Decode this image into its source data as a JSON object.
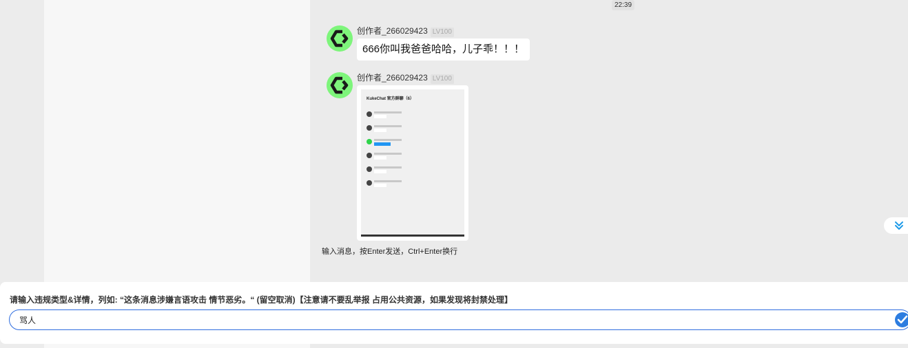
{
  "chat": {
    "timestamp": "22:39",
    "messages": [
      {
        "sender": "创作者_266029423",
        "level": "LV100",
        "text": "666你叫我爸爸哈哈，儿子乖！！！"
      },
      {
        "sender": "创作者_266029423",
        "level": "LV100",
        "image": {
          "title": "KukeChat 官方群聊（6）"
        }
      }
    ],
    "input_hint": "输入消息，按Enter发送，Ctrl+Enter换行"
  },
  "report": {
    "label": "请输入违规类型&详情，列如: “这条消息涉嫌言语攻击 情节恶劣。“ (留空取消)【注意请不要乱举报 占用公共资源，如果发现将封禁处理】",
    "value": "骂人"
  },
  "icons": {
    "avatar": "logo-icon",
    "scroll_down": "double-chevron-down-icon",
    "confirm": "check-icon"
  },
  "colors": {
    "accent": "#2d6cdf",
    "avatar_bg": "#7ef57b",
    "scroll_icon": "#1e9be8"
  }
}
